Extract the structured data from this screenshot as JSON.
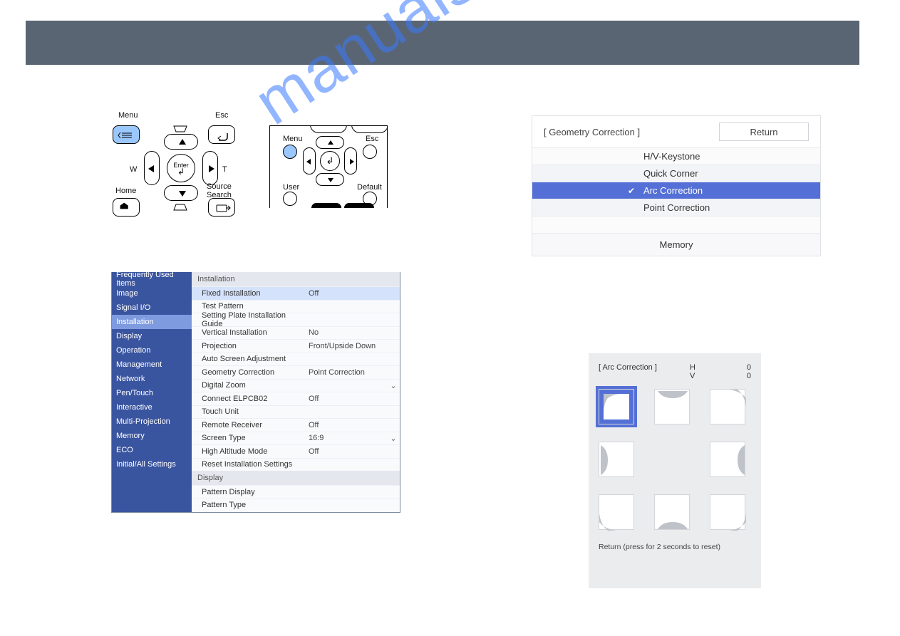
{
  "watermark": "manualshive.com",
  "panelRemote": {
    "menu": "Menu",
    "esc": "Esc",
    "w": "W",
    "t": "T",
    "enter": "Enter",
    "home": "Home",
    "sourceSearch": "Source\nSearch"
  },
  "projRemote": {
    "menu": "Menu",
    "esc": "Esc",
    "user": "User",
    "default": "Default"
  },
  "menu": {
    "sidebar": [
      "Frequently Used Items",
      "Image",
      "Signal I/O",
      "Installation",
      "Display",
      "Operation",
      "Management",
      "Network",
      "Pen/Touch",
      "Interactive",
      "Multi-Projection",
      "Memory",
      "ECO",
      "Initial/All Settings"
    ],
    "sidebar_selected_index": 3,
    "sections": [
      {
        "header": "Installation",
        "rows": [
          {
            "label": "Fixed Installation",
            "value": "Off",
            "selected": true
          },
          {
            "label": "Test Pattern",
            "value": ""
          },
          {
            "label": "Setting Plate Installation Guide",
            "value": ""
          },
          {
            "label": "Vertical Installation",
            "value": "No"
          },
          {
            "label": "Projection",
            "value": "Front/Upside Down"
          },
          {
            "label": "Auto Screen Adjustment",
            "value": ""
          },
          {
            "label": "Geometry Correction",
            "value": "Point Correction"
          },
          {
            "label": "Digital Zoom",
            "value": "",
            "chev": true
          },
          {
            "label": "Connect ELPCB02",
            "value": "Off"
          },
          {
            "label": "Touch Unit",
            "value": ""
          },
          {
            "label": "Remote Receiver",
            "value": "Off"
          },
          {
            "label": "Screen Type",
            "value": "16:9",
            "chev": true
          },
          {
            "label": "High Altitude Mode",
            "value": "Off"
          },
          {
            "label": "Reset Installation Settings",
            "value": ""
          }
        ]
      },
      {
        "header": "Display",
        "rows": [
          {
            "label": "Pattern Display",
            "value": ""
          },
          {
            "label": "Pattern Type",
            "value": ""
          }
        ]
      }
    ]
  },
  "geometry": {
    "title": "[ Geometry Correction ]",
    "return": "Return",
    "items": [
      "H/V-Keystone",
      "Quick Corner",
      "Arc Correction",
      "Point Correction"
    ],
    "selected_index": 2,
    "footer": "Memory"
  },
  "arc": {
    "title": "[ Arc Correction ]",
    "h_label": "H",
    "v_label": "V",
    "h_value": "0",
    "v_value": "0",
    "footer": "Return (press for 2 seconds to reset)"
  }
}
